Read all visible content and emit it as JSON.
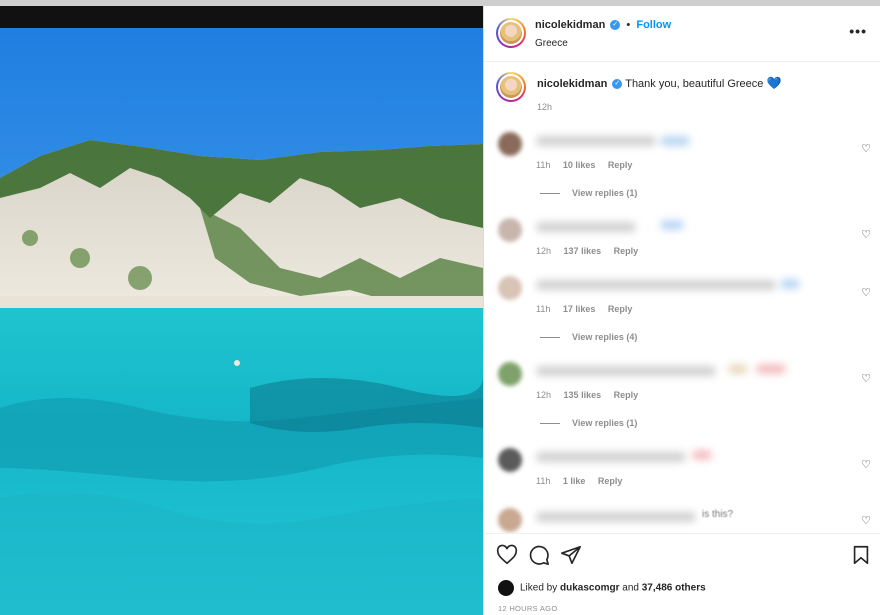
{
  "post": {
    "username": "nicolekidman",
    "follow_label": "Follow",
    "location": "Greece",
    "more_label": "•••",
    "verified_mark": "✓"
  },
  "caption": {
    "username": "nicolekidman",
    "text": "Thank you, beautiful Greece",
    "heart": "💙",
    "time": "12h"
  },
  "comments": [
    {
      "time": "11h",
      "likes": "10 likes",
      "reply": "Reply",
      "view_replies": "View replies (1)"
    },
    {
      "time": "12h",
      "likes": "137 likes",
      "reply": "Reply",
      "view_replies": ""
    },
    {
      "time": "11h",
      "likes": "17 likes",
      "reply": "Reply",
      "view_replies": "View replies (4)"
    },
    {
      "time": "12h",
      "likes": "135 likes",
      "reply": "Reply",
      "view_replies": "View replies (1)"
    },
    {
      "time": "11h",
      "likes": "1 like",
      "reply": "Reply",
      "view_replies": ""
    },
    {
      "partial_text": "is this?"
    }
  ],
  "footer": {
    "liked_by_prefix": "Liked by",
    "liked_by_user": "dukascomgr",
    "and_word": "and",
    "others": "37,486 others",
    "posted": "12 HOURS AGO"
  },
  "icons": {
    "like": "heart-outline-icon",
    "comment": "comment-bubble-icon",
    "share": "paper-plane-icon",
    "save": "bookmark-icon",
    "comment_like": "small-heart-icon"
  },
  "colors": {
    "link_blue": "#0095f6",
    "verified_blue": "#3897f0",
    "muted": "#8e8e8e"
  }
}
